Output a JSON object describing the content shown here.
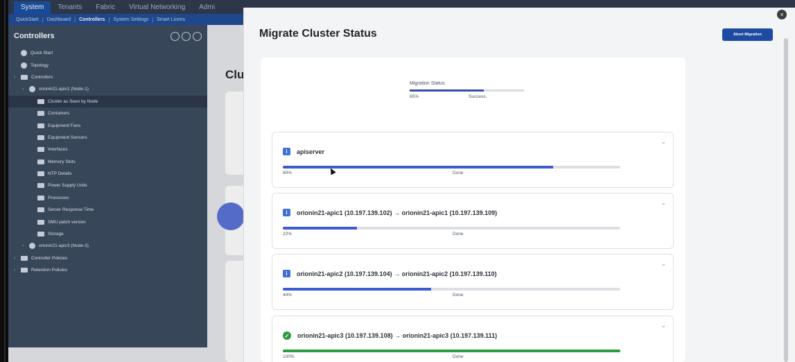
{
  "app": {
    "top_tabs": [
      {
        "label": "System",
        "active": true
      },
      {
        "label": "Tenants",
        "active": false
      },
      {
        "label": "Fabric",
        "active": false
      },
      {
        "label": "Virtual Networking",
        "active": false
      },
      {
        "label": "Admi",
        "active": false
      }
    ],
    "sub_tabs": [
      {
        "label": "QuickStart",
        "active": false
      },
      {
        "label": "Dashboard",
        "active": false
      },
      {
        "label": "Controllers",
        "active": true
      },
      {
        "label": "System Settings",
        "active": false
      },
      {
        "label": "Smart Licens",
        "active": false
      }
    ],
    "sidebar": {
      "title": "Controllers",
      "items": [
        {
          "label": "Quick Start",
          "indent": 0,
          "icon": "quickstart-icon"
        },
        {
          "label": "Topology",
          "indent": 0,
          "icon": "topology-icon"
        },
        {
          "label": "Controllers",
          "indent": 0,
          "icon": "folder-icon"
        },
        {
          "label": "orionin21-apic1 (Node-1)",
          "indent": 1,
          "icon": "node-icon"
        },
        {
          "label": "Cluster as Seen by Node",
          "indent": 2,
          "icon": "folder-icon",
          "selected": true
        },
        {
          "label": "Containers",
          "indent": 2,
          "icon": "folder-icon"
        },
        {
          "label": "Equipment Fans",
          "indent": 2,
          "icon": "folder-icon"
        },
        {
          "label": "Equipment Sensors",
          "indent": 2,
          "icon": "folder-icon"
        },
        {
          "label": "Interfaces",
          "indent": 2,
          "icon": "folder-icon"
        },
        {
          "label": "Memory Slots",
          "indent": 2,
          "icon": "folder-icon"
        },
        {
          "label": "NTP Details",
          "indent": 2,
          "icon": "folder-icon"
        },
        {
          "label": "Power Supply Units",
          "indent": 2,
          "icon": "folder-icon"
        },
        {
          "label": "Processes",
          "indent": 2,
          "icon": "folder-icon"
        },
        {
          "label": "Server Response Time",
          "indent": 2,
          "icon": "file-icon"
        },
        {
          "label": "SMU patch version",
          "indent": 2,
          "icon": "folder-icon"
        },
        {
          "label": "Storage",
          "indent": 2,
          "icon": "folder-icon"
        },
        {
          "label": "orionin21-apic3 (Node-3)",
          "indent": 1,
          "icon": "node-icon"
        },
        {
          "label": "Controller Policies",
          "indent": 0,
          "icon": "file-icon"
        },
        {
          "label": "Retention Policies",
          "indent": 0,
          "icon": "folder-icon"
        }
      ]
    },
    "content": {
      "heading": "Clu"
    }
  },
  "modal": {
    "title": "Migrate Cluster Status",
    "abort_label": "Abort Migration",
    "close_symbol": "×",
    "overall": {
      "label": "Migration Status",
      "percent_text": "65%",
      "progress": 0.65,
      "status": "Success."
    },
    "items": [
      {
        "name": "apiserver",
        "percent_text": "80%",
        "progress": 0.8,
        "status": "Done",
        "icon": "info-icon",
        "color": "#3d5bd1"
      },
      {
        "name": "orionin21-apic1 (10.197.139.102) → orionin21-apic1 (10.197.139.109)",
        "percent_text": "22%",
        "progress": 0.22,
        "status": "Done",
        "icon": "info-icon",
        "color": "#3d5bd1"
      },
      {
        "name": "orionin21-apic2 (10.197.139.104) → orionin21-apic2 (10.197.139.110)",
        "percent_text": "44%",
        "progress": 0.44,
        "status": "Done",
        "icon": "info-icon",
        "color": "#3d5bd1"
      },
      {
        "name": "orionin21-apic3 (10.197.139.108) → orionin21-apic3 (10.197.139.111)",
        "percent_text": "100%",
        "progress": 1.0,
        "status": "Done",
        "icon": "check-circle-icon",
        "color": "#2e9b3f"
      }
    ]
  }
}
